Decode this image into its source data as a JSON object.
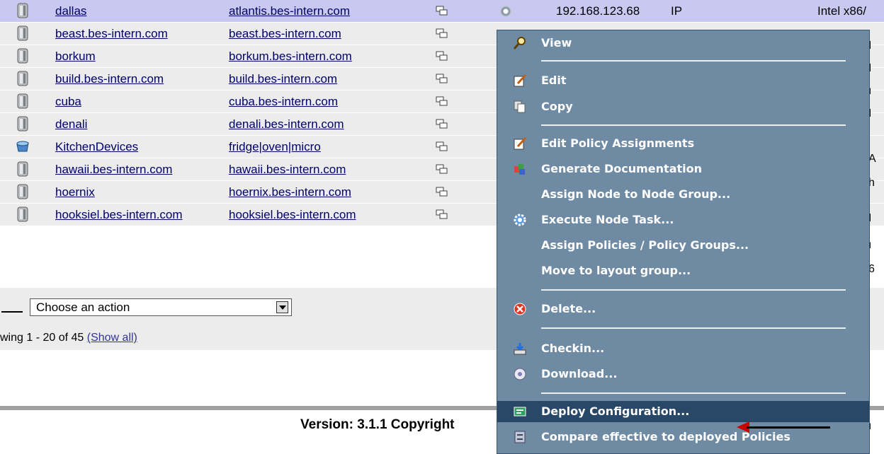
{
  "rows": [
    {
      "name": "dallas",
      "host": "atlantis.bes-intern.com",
      "ip": "192.168.123.68",
      "proto": "IP",
      "arch": "Intel x86/",
      "icon": "server-icon",
      "highlighted": true,
      "right": ""
    },
    {
      "name": "beast.bes-intern.com",
      "host": "beast.bes-intern.com",
      "icon": "server-icon",
      "right": "I"
    },
    {
      "name": "borkum",
      "host": "borkum.bes-intern.com",
      "icon": "server-icon",
      "right": "I"
    },
    {
      "name": "build.bes-intern.com",
      "host": "build.bes-intern.com",
      "icon": "server-icon",
      "right": "ı"
    },
    {
      "name": "cuba",
      "host": "cuba.bes-intern.com",
      "icon": "server-icon",
      "right": "I"
    },
    {
      "name": "denali",
      "host": "denali.bes-intern.com",
      "icon": "server-icon",
      "right": "A"
    },
    {
      "name": "KitchenDevices",
      "host": "fridge|oven|micro",
      "icon": "device-group-icon",
      "right": "h"
    },
    {
      "name": "hawaii.bes-intern.com",
      "host": "hawaii.bes-intern.com",
      "icon": "server-icon",
      "right": "I"
    },
    {
      "name": "hoernix",
      "host": "hoernix.bes-intern.com",
      "icon": "server-icon",
      "right": "ı"
    },
    {
      "name": "hooksiel.bes-intern.com",
      "host": "hooksiel.bes-intern.com",
      "icon": "server-icon",
      "right": "6"
    }
  ],
  "action_select": {
    "selected": "Choose an action"
  },
  "paging": {
    "text": "wing 1 - 20 of 45 ",
    "show_all": "(Show all)"
  },
  "footer": {
    "version": "Version: 3.1.1  Copyright",
    "right": "ı"
  },
  "menu": {
    "items": [
      {
        "label": "View",
        "icon": "magnifier-icon"
      },
      {
        "label": "Edit",
        "icon": "edit-icon"
      },
      {
        "label": "Copy",
        "icon": "copy-icon"
      },
      {
        "label": "Edit Policy Assignments",
        "icon": "edit-icon"
      },
      {
        "label": "Generate Documentation",
        "icon": "documentation-icon"
      },
      {
        "label": "Assign Node to Node Group...",
        "icon": ""
      },
      {
        "label": "Execute Node Task...",
        "icon": "gear-task-icon"
      },
      {
        "label": "Assign Policies / Policy Groups...",
        "icon": ""
      },
      {
        "label": "Move to layout group...",
        "icon": ""
      },
      {
        "label": "Delete...",
        "icon": "delete-icon"
      },
      {
        "label": "Checkin...",
        "icon": "checkin-icon"
      },
      {
        "label": "Download...",
        "icon": "download-icon"
      },
      {
        "label": "Deploy Configuration...",
        "icon": "deploy-icon",
        "active": true
      },
      {
        "label": "Compare effective to deployed Policies",
        "icon": "compare-icon"
      }
    ]
  },
  "colors": {
    "menu_bg": "#6f8ba4",
    "menu_active": "#294868",
    "row_bg": "#ececec",
    "row_highlight": "#c8c8f0",
    "arrow": "#d00000"
  }
}
